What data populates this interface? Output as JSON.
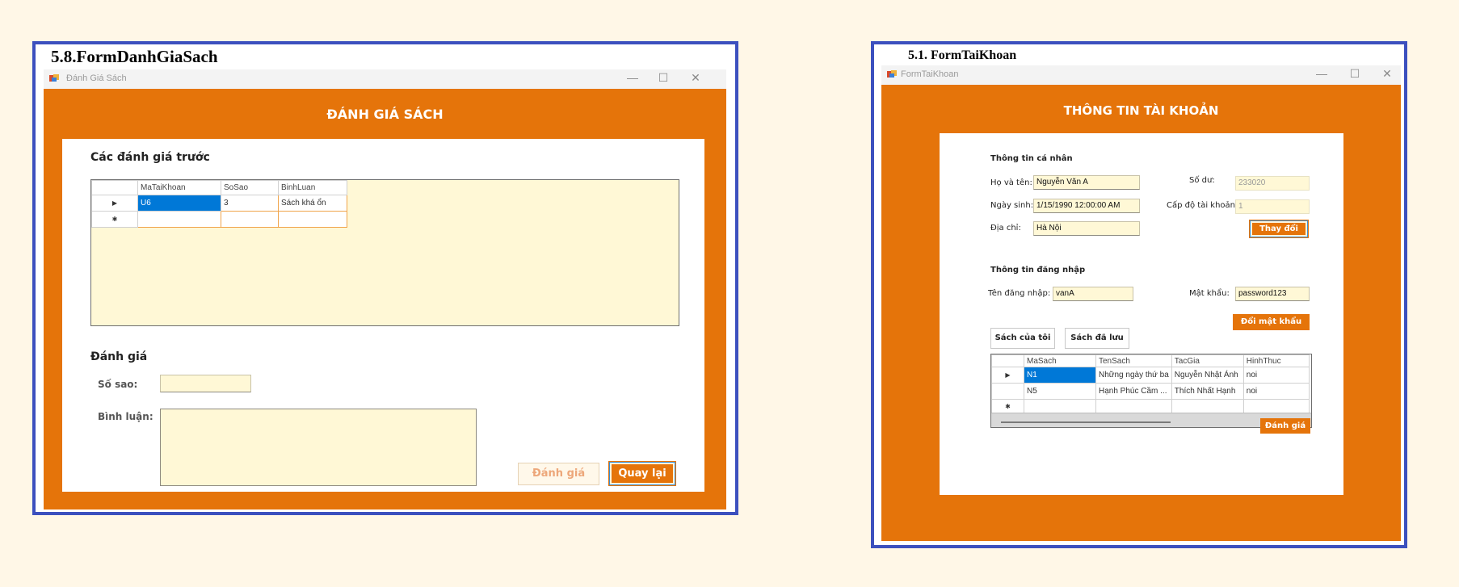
{
  "left": {
    "caption": "5.8.FormDanhGiaSach",
    "window_title": "Đánh Giá Sách",
    "form_title": "ĐÁNH GIÁ SÁCH",
    "prev_reviews_heading": "Các đánh giá trước",
    "grid": {
      "columns": [
        "MaTaiKhoan",
        "SoSao",
        "BinhLuan"
      ],
      "rows": [
        {
          "marker": "▶",
          "cells": [
            "U6",
            "3",
            "Sách khá ổn"
          ]
        },
        {
          "marker": "✱",
          "cells": [
            "",
            "",
            ""
          ]
        }
      ]
    },
    "review_heading": "Đánh giá",
    "stars_label": "Số sao:",
    "stars_value": "",
    "comment_label": "Bình luận:",
    "comment_value": "",
    "submit_button": "Đánh giá",
    "back_button": "Quay lại"
  },
  "right": {
    "caption": "5.1.  FormTaiKhoan",
    "window_title": "FormTaiKhoan",
    "form_title": "THÔNG TIN TÀI KHOẢN",
    "personal_heading": "Thông tin cá nhân",
    "name_label": "Họ và tên:",
    "name_value": "Nguyễn Văn A",
    "balance_label": "Số dư:",
    "balance_value": "233020",
    "dob_label": "Ngày sinh:",
    "dob_value": "1/15/1990 12:00:00 AM",
    "level_label": "Cấp độ tài khoản:",
    "level_value": "1",
    "address_label": "Địa chỉ:",
    "address_value": "Hà Nội",
    "change_button": "Thay đổi",
    "login_heading": "Thông tin đăng nhập",
    "username_label": "Tên đăng nhập:",
    "username_value": "vanA",
    "password_label": "Mật khẩu:",
    "password_value": "password123",
    "change_password_button": "Đổi mật khẩu",
    "my_books_button": "Sách của tôi",
    "saved_books_button": "Sách đã lưu",
    "grid": {
      "columns": [
        "MaSach",
        "TenSach",
        "TacGia",
        "HinhThuc"
      ],
      "rows": [
        {
          "marker": "▶",
          "cells": [
            "N1",
            "Những ngày thứ ba",
            "Nguyễn Nhật Ánh",
            "noi"
          ]
        },
        {
          "marker": "",
          "cells": [
            "N5",
            "Hạnh Phúc Cầm ...",
            "Thích Nhất Hạnh",
            "noi"
          ]
        },
        {
          "marker": "✱",
          "cells": [
            "",
            "",
            "",
            ""
          ]
        }
      ]
    },
    "rate_button": "Đánh giá"
  },
  "window_controls": {
    "minimize": "—",
    "maximize": "☐",
    "close": "✕"
  },
  "colors": {
    "accent": "#e5740a",
    "frame_border": "#3c50be",
    "input_bg": "#fff8d6",
    "selection": "#0078d7",
    "background": "#fff7e7"
  }
}
